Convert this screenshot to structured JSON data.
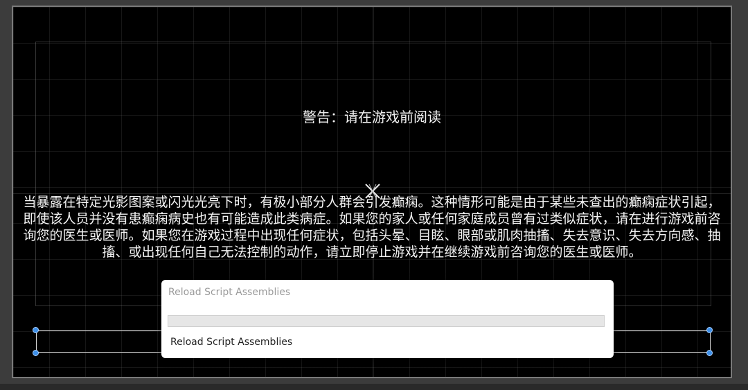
{
  "scene": {
    "warning_title": "警告：请在游戏前阅读",
    "warning_body": "当暴露在特定光影图案或闪光光亮下时，有极小部分人群会引发癫痫。这种情形可能是由于某些未查出的癫痫症状引起，即使该人员并没有患癫痫病史也有可能造成此类病症。如果您的家人或任何家庭成员曾有过类似症状，请在进行游戏前咨询您的医生或医师。如果您在游戏过程中出现任何症状，包括头晕、目眩、眼部或肌肉抽搐、失去意识、失去方向感、抽搐、或出现任何自己无法控制的动作，请立即停止游戏并在继续游戏前咨询您的医生或医师。"
  },
  "dialog": {
    "title": "Reload Script Assemblies",
    "info": "Reload Script Assemblies",
    "progress_fraction": 0
  },
  "colors": {
    "viewport_bg": "#000000",
    "text": "#f2f2f2",
    "handle": "#3d8fe8",
    "dialog_bg": "#ffffff"
  },
  "icons": {
    "pivot": "pivot-cross-icon",
    "handle": "rect-handle-icon"
  }
}
